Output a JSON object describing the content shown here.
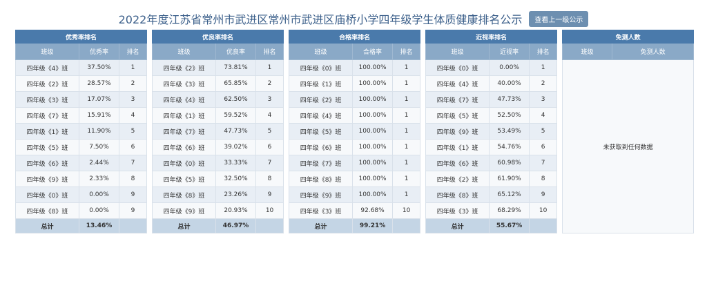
{
  "page": {
    "title": "2022年度江苏省常州市武进区常州市武进区庙桥小学四年级学生体质健康排名公示",
    "up_button": "查看上一级公示"
  },
  "tables": [
    {
      "caption": "优秀率排名",
      "columns": [
        "班级",
        "优秀率",
        "排名"
      ],
      "rows": [
        [
          "四年级《4》班",
          "37.50%",
          "1"
        ],
        [
          "四年级《2》班",
          "28.57%",
          "2"
        ],
        [
          "四年级《3》班",
          "17.07%",
          "3"
        ],
        [
          "四年级《7》班",
          "15.91%",
          "4"
        ],
        [
          "四年级《1》班",
          "11.90%",
          "5"
        ],
        [
          "四年级《5》班",
          "7.50%",
          "6"
        ],
        [
          "四年级《6》班",
          "2.44%",
          "7"
        ],
        [
          "四年级《9》班",
          "2.33%",
          "8"
        ],
        [
          "四年级《0》班",
          "0.00%",
          "9"
        ],
        [
          "四年级《8》班",
          "0.00%",
          "9"
        ]
      ],
      "total": [
        "总计",
        "13.46%",
        ""
      ]
    },
    {
      "caption": "优良率排名",
      "columns": [
        "班级",
        "优良率",
        "排名"
      ],
      "rows": [
        [
          "四年级《2》班",
          "73.81%",
          "1"
        ],
        [
          "四年级《3》班",
          "65.85%",
          "2"
        ],
        [
          "四年级《4》班",
          "62.50%",
          "3"
        ],
        [
          "四年级《1》班",
          "59.52%",
          "4"
        ],
        [
          "四年级《7》班",
          "47.73%",
          "5"
        ],
        [
          "四年级《6》班",
          "39.02%",
          "6"
        ],
        [
          "四年级《0》班",
          "33.33%",
          "7"
        ],
        [
          "四年级《5》班",
          "32.50%",
          "8"
        ],
        [
          "四年级《8》班",
          "23.26%",
          "9"
        ],
        [
          "四年级《9》班",
          "20.93%",
          "10"
        ]
      ],
      "total": [
        "总计",
        "46.97%",
        ""
      ]
    },
    {
      "caption": "合格率排名",
      "columns": [
        "班级",
        "合格率",
        "排名"
      ],
      "rows": [
        [
          "四年级《0》班",
          "100.00%",
          "1"
        ],
        [
          "四年级《1》班",
          "100.00%",
          "1"
        ],
        [
          "四年级《2》班",
          "100.00%",
          "1"
        ],
        [
          "四年级《4》班",
          "100.00%",
          "1"
        ],
        [
          "四年级《5》班",
          "100.00%",
          "1"
        ],
        [
          "四年级《6》班",
          "100.00%",
          "1"
        ],
        [
          "四年级《7》班",
          "100.00%",
          "1"
        ],
        [
          "四年级《8》班",
          "100.00%",
          "1"
        ],
        [
          "四年级《9》班",
          "100.00%",
          "1"
        ],
        [
          "四年级《3》班",
          "92.68%",
          "10"
        ]
      ],
      "total": [
        "总计",
        "99.21%",
        ""
      ]
    },
    {
      "caption": "近视率排名",
      "columns": [
        "班级",
        "近视率",
        "排名"
      ],
      "rows": [
        [
          "四年级《0》班",
          "0.00%",
          "1"
        ],
        [
          "四年级《4》班",
          "40.00%",
          "2"
        ],
        [
          "四年级《7》班",
          "47.73%",
          "3"
        ],
        [
          "四年级《5》班",
          "52.50%",
          "4"
        ],
        [
          "四年级《9》班",
          "53.49%",
          "5"
        ],
        [
          "四年级《1》班",
          "54.76%",
          "6"
        ],
        [
          "四年级《6》班",
          "60.98%",
          "7"
        ],
        [
          "四年级《2》班",
          "61.90%",
          "8"
        ],
        [
          "四年级《8》班",
          "65.12%",
          "9"
        ],
        [
          "四年级《3》班",
          "68.29%",
          "10"
        ]
      ],
      "total": [
        "总计",
        "55.67%",
        ""
      ]
    }
  ],
  "exempt": {
    "caption": "免测人数",
    "columns": [
      "班级",
      "免测人数"
    ],
    "empty_text": "未获取到任何数据"
  }
}
